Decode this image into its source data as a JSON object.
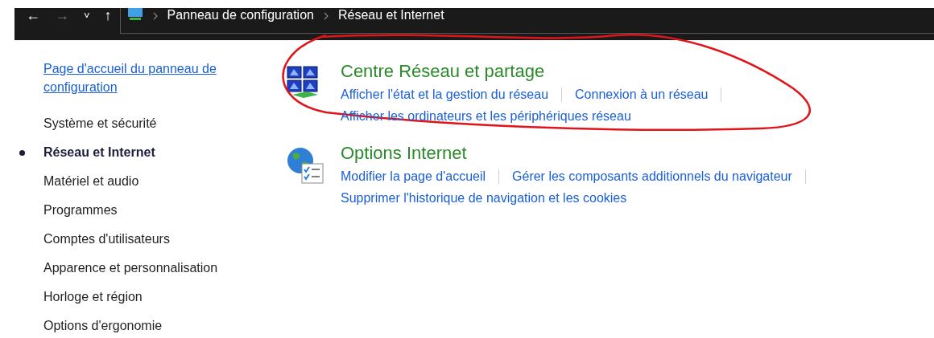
{
  "address_bar": {
    "back": "←",
    "forward": "→",
    "recent": "˅",
    "up": "↑",
    "breadcrumbs": [
      "Panneau de configuration",
      "Réseau et Internet"
    ]
  },
  "sidebar": {
    "home_link": "Page d'accueil du panneau de configuration",
    "items": [
      {
        "label": "Système et sécurité",
        "selected": false
      },
      {
        "label": "Réseau et Internet",
        "selected": true
      },
      {
        "label": "Matériel et audio",
        "selected": false
      },
      {
        "label": "Programmes",
        "selected": false
      },
      {
        "label": "Comptes d'utilisateurs",
        "selected": false
      },
      {
        "label": "Apparence et personnalisation",
        "selected": false
      },
      {
        "label": "Horloge et région",
        "selected": false
      },
      {
        "label": "Options d'ergonomie",
        "selected": false
      }
    ]
  },
  "categories": [
    {
      "kind": "network",
      "title": "Centre Réseau et partage",
      "annotated": true,
      "link_rows": [
        [
          "Afficher l'état et la gestion du réseau",
          "Connexion à un réseau"
        ],
        [
          "Afficher les ordinateurs et les périphériques réseau"
        ]
      ]
    },
    {
      "kind": "internet",
      "title": "Options Internet",
      "annotated": false,
      "link_rows": [
        [
          "Modifier la page d'accueil",
          "Gérer les composants additionnels du navigateur"
        ],
        [
          "Supprimer l'historique de navigation et les cookies"
        ]
      ]
    }
  ]
}
